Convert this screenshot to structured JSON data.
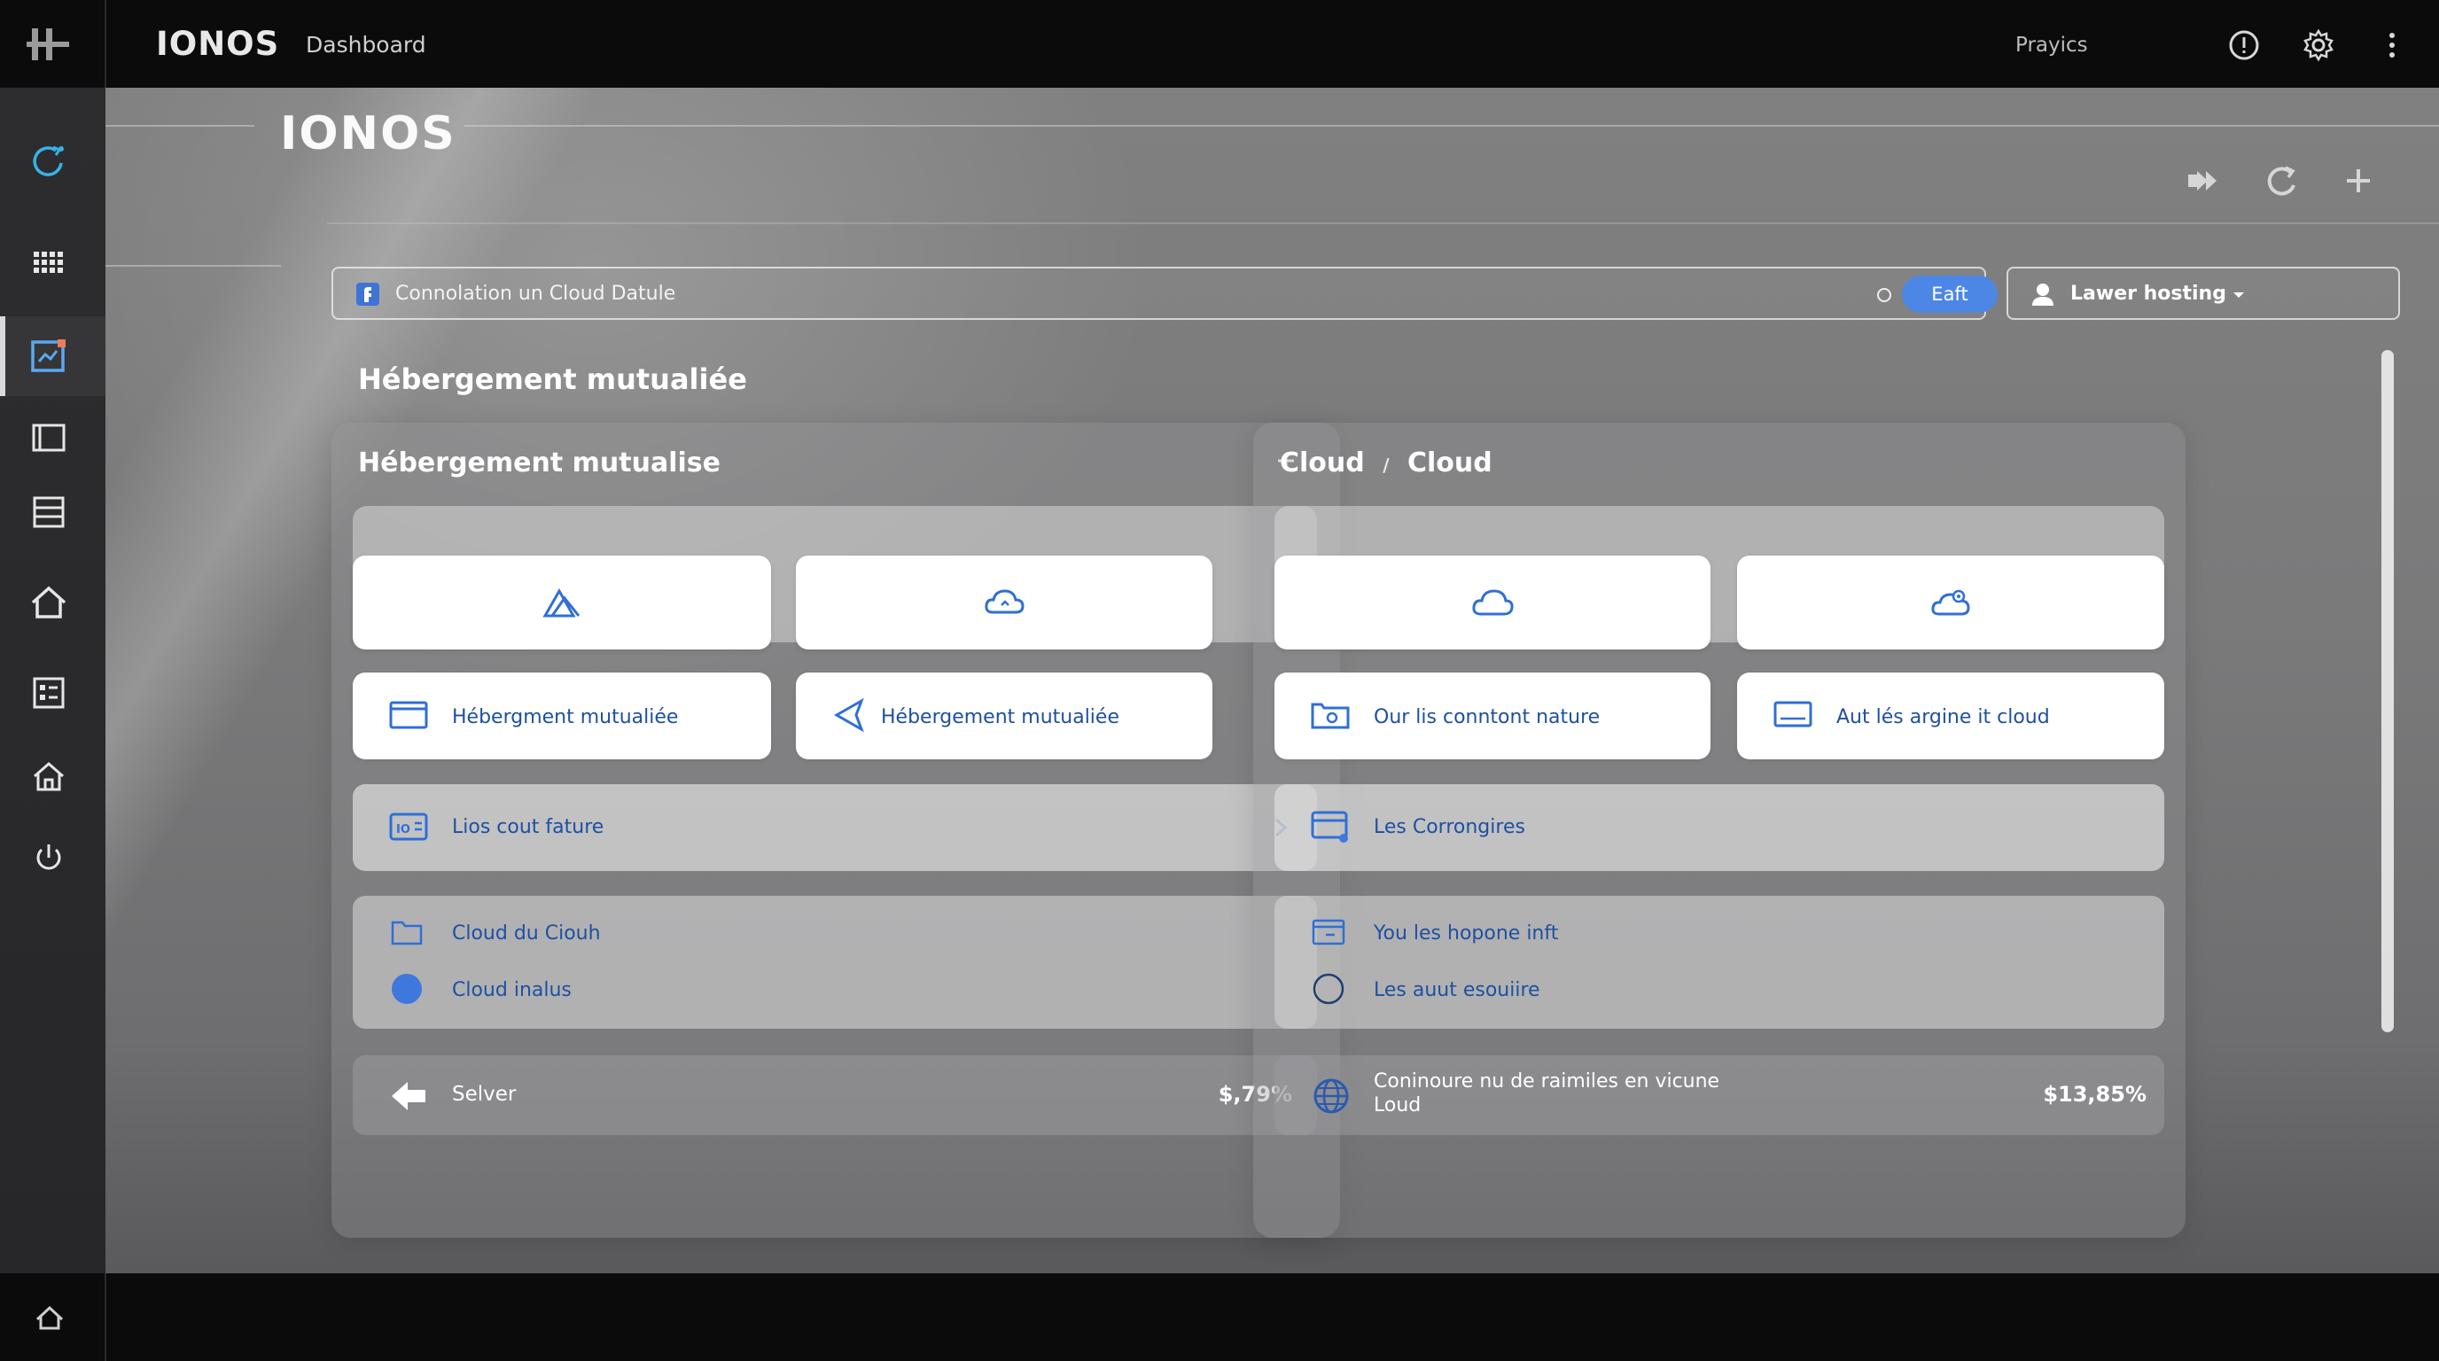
{
  "topbar": {
    "brand": "IONOS",
    "breadcrumb": "Dashboard",
    "user_label": "Prayics"
  },
  "page": {
    "brand": "IONOS",
    "search_text": "Connolation un Cloud Datule",
    "search_button": "Eaft",
    "dropdown_label": "Lawer hosting",
    "section_title": "Hébergement mutualiée"
  },
  "panel_left": {
    "title": "Hébergement mutualise",
    "row_cards": [
      "Hébergment mutualiée",
      "Hébergement mutualiée"
    ],
    "wide_row": "Lios cout fature",
    "list": [
      "Cloud du Ciouh",
      "Cloud inalus"
    ],
    "footer_label": "Selver",
    "footer_value": "$,79%"
  },
  "panel_right": {
    "title_a": "Cloud",
    "title_sep": "/",
    "title_b": "Cloud",
    "row_cards": [
      "Our lis conntont nature",
      "Aut lés argine it cloud"
    ],
    "wide_row": "Les Corrongires",
    "list": [
      "You les hopone inft",
      "Les auut esouiire"
    ],
    "footer_label_1": "Coninoure nu de raimiles en vicune",
    "footer_label_2": "Loud",
    "footer_value": "$13,85%"
  },
  "colors": {
    "accent": "#4d87e5",
    "link_text": "#1e50a0",
    "icon_blue": "#2f6fd6",
    "sidebar_bg": "#2b2b2d",
    "topbar_bg": "#0b0b0c"
  }
}
